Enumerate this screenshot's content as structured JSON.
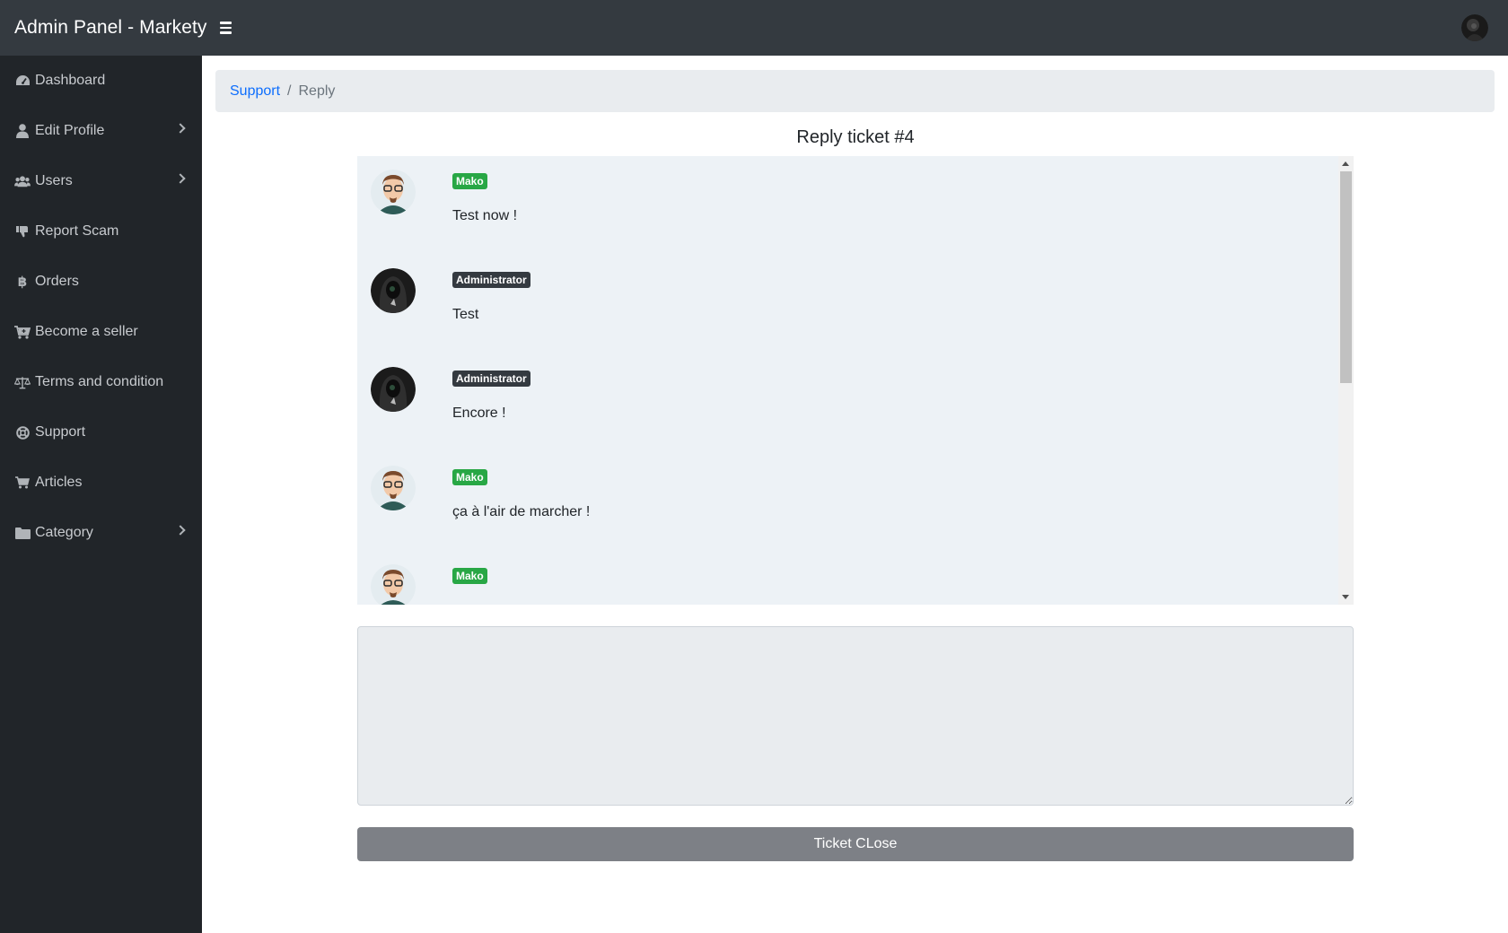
{
  "app": {
    "title": "Admin Panel - Markety"
  },
  "header": {
    "menu_icon": "hamburger-icon",
    "avatar_icon": "user-avatar"
  },
  "sidebar": {
    "items": [
      {
        "label": "Dashboard",
        "icon": "tachometer-icon",
        "has_submenu": false
      },
      {
        "label": "Edit Profile",
        "icon": "user-icon",
        "has_submenu": true
      },
      {
        "label": "Users",
        "icon": "users-icon",
        "has_submenu": true
      },
      {
        "label": "Report Scam",
        "icon": "thumbs-down-icon",
        "has_submenu": false
      },
      {
        "label": "Orders",
        "icon": "bitcoin-icon",
        "has_submenu": false
      },
      {
        "label": "Become a seller",
        "icon": "cart-plus-icon",
        "has_submenu": false
      },
      {
        "label": "Terms and condition",
        "icon": "balance-scale-icon",
        "has_submenu": false
      },
      {
        "label": "Support",
        "icon": "life-ring-icon",
        "has_submenu": false
      },
      {
        "label": "Articles",
        "icon": "cart-icon",
        "has_submenu": false
      },
      {
        "label": "Category",
        "icon": "folder-icon",
        "has_submenu": true
      }
    ]
  },
  "breadcrumb": {
    "link": "Support",
    "separator": "/",
    "current": "Reply"
  },
  "ticket": {
    "title": "Reply ticket #4"
  },
  "messages": [
    {
      "author": "Mako",
      "role": "user",
      "text": "Test now !"
    },
    {
      "author": "Administrator",
      "role": "admin",
      "text": "Test"
    },
    {
      "author": "Administrator",
      "role": "admin",
      "text": "Encore !"
    },
    {
      "author": "Mako",
      "role": "user",
      "text": "ça à l'air de marcher !"
    },
    {
      "author": "Mako",
      "role": "user",
      "text": ""
    }
  ],
  "reply": {
    "value": "",
    "placeholder": ""
  },
  "actions": {
    "close_label": "Ticket CLose"
  },
  "colors": {
    "topbar": "#343a40",
    "sidebar": "#212529",
    "user_badge": "#28a745",
    "admin_badge": "#343a40",
    "link": "#0d6efd",
    "button": "#7d8086"
  }
}
